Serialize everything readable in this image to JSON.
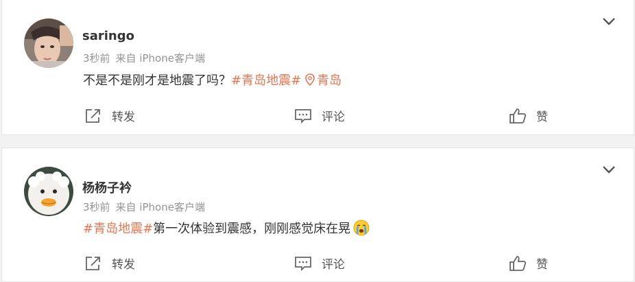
{
  "posts": [
    {
      "username": "saringo",
      "time": "3秒前",
      "source": "来自 iPhone客户端",
      "text_before": "不是不是刚才是地震了吗？",
      "hashtag": "#青岛地震#",
      "text_after": "",
      "location": "青岛",
      "repost_label": "转发",
      "comment_label": "评论",
      "like_label": "赞"
    },
    {
      "username": "杨杨子衿",
      "time": "3秒前",
      "source": "来自 iPhone客户端",
      "text_before": "",
      "hashtag": "#青岛地震#",
      "text_after": "第一次体验到震感，刚刚感觉床在晃",
      "emoji": "crying-face-emoji",
      "repost_label": "转发",
      "comment_label": "评论",
      "like_label": "赞"
    }
  ],
  "colors": {
    "accent": "#eb7350",
    "text": "#333333",
    "meta": "#939393",
    "background": "#f2f2f2"
  }
}
